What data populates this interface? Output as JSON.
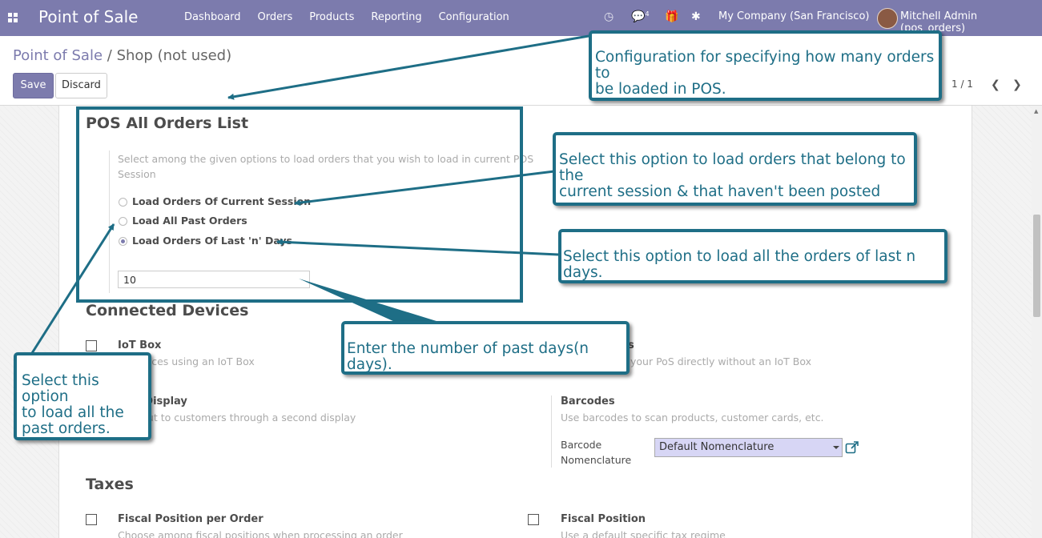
{
  "navbar": {
    "brand": "Point of Sale",
    "menu": [
      "Dashboard",
      "Orders",
      "Products",
      "Reporting",
      "Configuration"
    ],
    "message_count": "4",
    "company": "My Company (San Francisco)",
    "user": "Mitchell Admin (pos_orders)",
    "color": "#7c7bad"
  },
  "control_panel": {
    "breadcrumb_parent": "Point of Sale",
    "breadcrumb_separator": "/",
    "breadcrumb_current": "Shop (not used)",
    "save_label": "Save",
    "discard_label": "Discard",
    "pager": "1 / 1"
  },
  "pos_orders": {
    "title": "POS All Orders List",
    "hint_line1": "Select among the given options to load orders that you wish to load in current POS",
    "hint_line2": "Session",
    "options": [
      {
        "label": "Load Orders Of Current Session",
        "checked": false
      },
      {
        "label": "Load All Past Orders",
        "checked": false
      },
      {
        "label": "Load Orders Of Last 'n' Days",
        "checked": true
      }
    ],
    "days_value": "10"
  },
  "connected_devices": {
    "title": "Connected Devices",
    "iot_title": "IoT Box",
    "iot_hint": "ct devices using an IoT Box",
    "right_hint": "s to your PoS directly without an IoT Box",
    "right_title_fragment": "s",
    "customer_display_title": "mer Display",
    "customer_display_hint": "heckout to customers through a second display",
    "barcodes_title": "Barcodes",
    "barcodes_hint": "Use barcodes to scan products, customer cards, etc.",
    "barcode_nomenclature_label_1": "Barcode",
    "barcode_nomenclature_label_2": "Nomenclature",
    "barcode_nomenclature_value": "Default Nomenclature"
  },
  "taxes": {
    "title": "Taxes",
    "fiscal_position_per_order_title": "Fiscal Position per Order",
    "fiscal_position_per_order_hint": "Choose among fiscal positions when processing an order",
    "fiscal_position_title": "Fiscal Position",
    "fiscal_position_hint": "Use a default specific tax regime"
  },
  "annotations": {
    "config_note": [
      "Configuration for specifying how many orders to",
      "be loaded in POS."
    ],
    "current_session_note": [
      "Select this option to load orders that belong to the",
      "current session & that haven't been posted"
    ],
    "last_n_days_note": "Select this option to load all the orders of last n days.",
    "days_input_note": "Enter the number of past days(n days).",
    "past_orders_note": [
      "Select this option",
      "to load all the",
      "past orders."
    ],
    "color": "#1e6e86"
  }
}
